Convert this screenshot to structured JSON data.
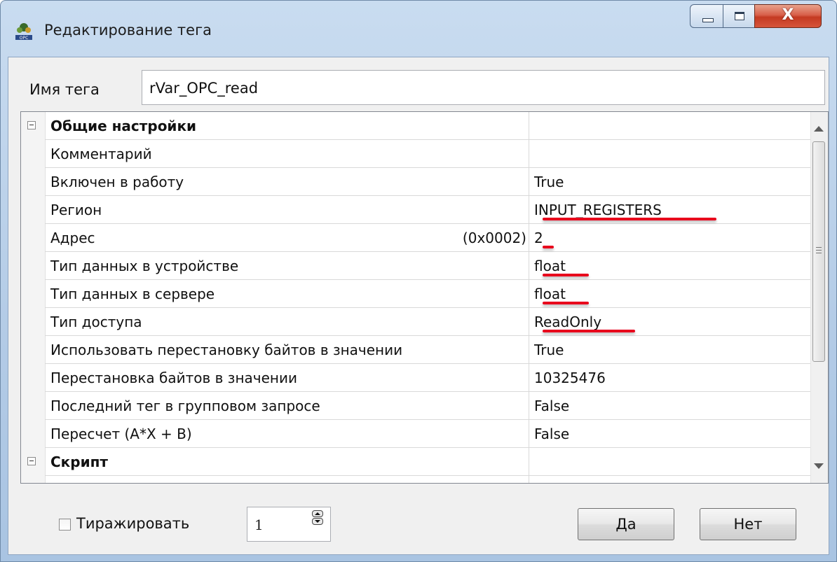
{
  "window": {
    "title": "Редактирование тега",
    "controls": {
      "minimize": "minimize",
      "maximize": "maximize",
      "close": "X"
    }
  },
  "tag_name": {
    "label": "Имя тега",
    "value": "rVar_OPC_read"
  },
  "properties": {
    "categories": [
      {
        "label": "Общие настройки"
      },
      {
        "label": "Скрипт"
      }
    ],
    "rows": [
      {
        "name": "Комментарий",
        "value": ""
      },
      {
        "name": "Включен в работу",
        "value": "True"
      },
      {
        "name": "Регион",
        "value": "INPUT_REGISTERS"
      },
      {
        "name": "Адрес",
        "hex": "(0x0002)",
        "value": "2"
      },
      {
        "name": "Тип данных в устройстве",
        "value": "float"
      },
      {
        "name": "Тип данных в сервере",
        "value": "float"
      },
      {
        "name": "Тип доступа",
        "value": "ReadOnly"
      },
      {
        "name": "Использовать перестановку байтов в значении",
        "value": "True"
      },
      {
        "name": "Перестановка байтов в значении",
        "value": "10325476"
      },
      {
        "name": "Последний тег в групповом запросе",
        "value": "False"
      },
      {
        "name": "Пересчет (A*X + B)",
        "value": "False"
      }
    ]
  },
  "footer": {
    "replicate_label": "Тиражировать",
    "replicate_checked": false,
    "count_value": "1",
    "yes_label": "Да",
    "no_label": "Нет"
  },
  "colors": {
    "highlight_underline": "#e8001c",
    "close_button": "#c43a22"
  }
}
